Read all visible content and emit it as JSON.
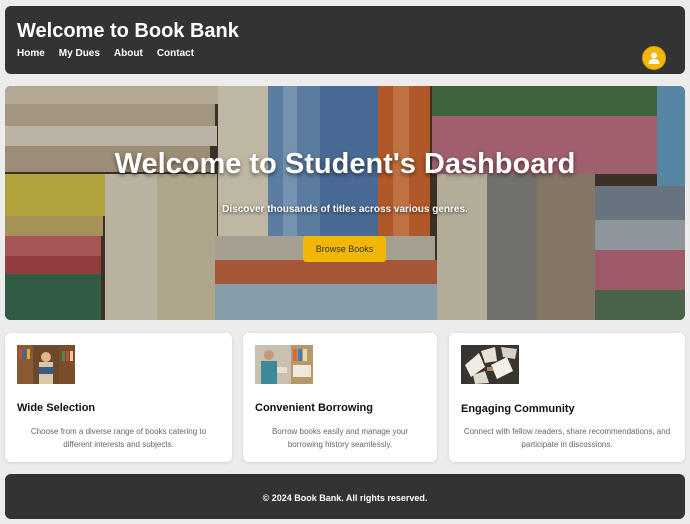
{
  "header": {
    "brand": "Welcome to Book Bank",
    "nav": [
      "Home",
      "My Dues",
      "About",
      "Contact"
    ]
  },
  "hero": {
    "title": "Welcome to Student's Dashboard",
    "subtitle": "Discover thousands of titles across various genres.",
    "button": "Browse Books"
  },
  "cards": [
    {
      "title": "Wide Selection",
      "text": "Choose from a diverse range of books catering to different interests and subjects.",
      "image": "library-shelves-photo"
    },
    {
      "title": "Convenient Borrowing",
      "text": "Borrow books easily and manage your borrowing history seamlessly.",
      "image": "bookstore-person-photo"
    },
    {
      "title": "Engaging Community",
      "text": "Connect with fellow readers, share recommendations, and participate in discussions.",
      "image": "open-books-photo"
    }
  ],
  "footer": {
    "text": "© 2024 Book Bank. All rights reserved."
  },
  "colors": {
    "header_bg": "#333333",
    "accent": "#f2b705",
    "page_bg": "#ececec"
  },
  "icons": [
    "user-avatar-icon"
  ]
}
